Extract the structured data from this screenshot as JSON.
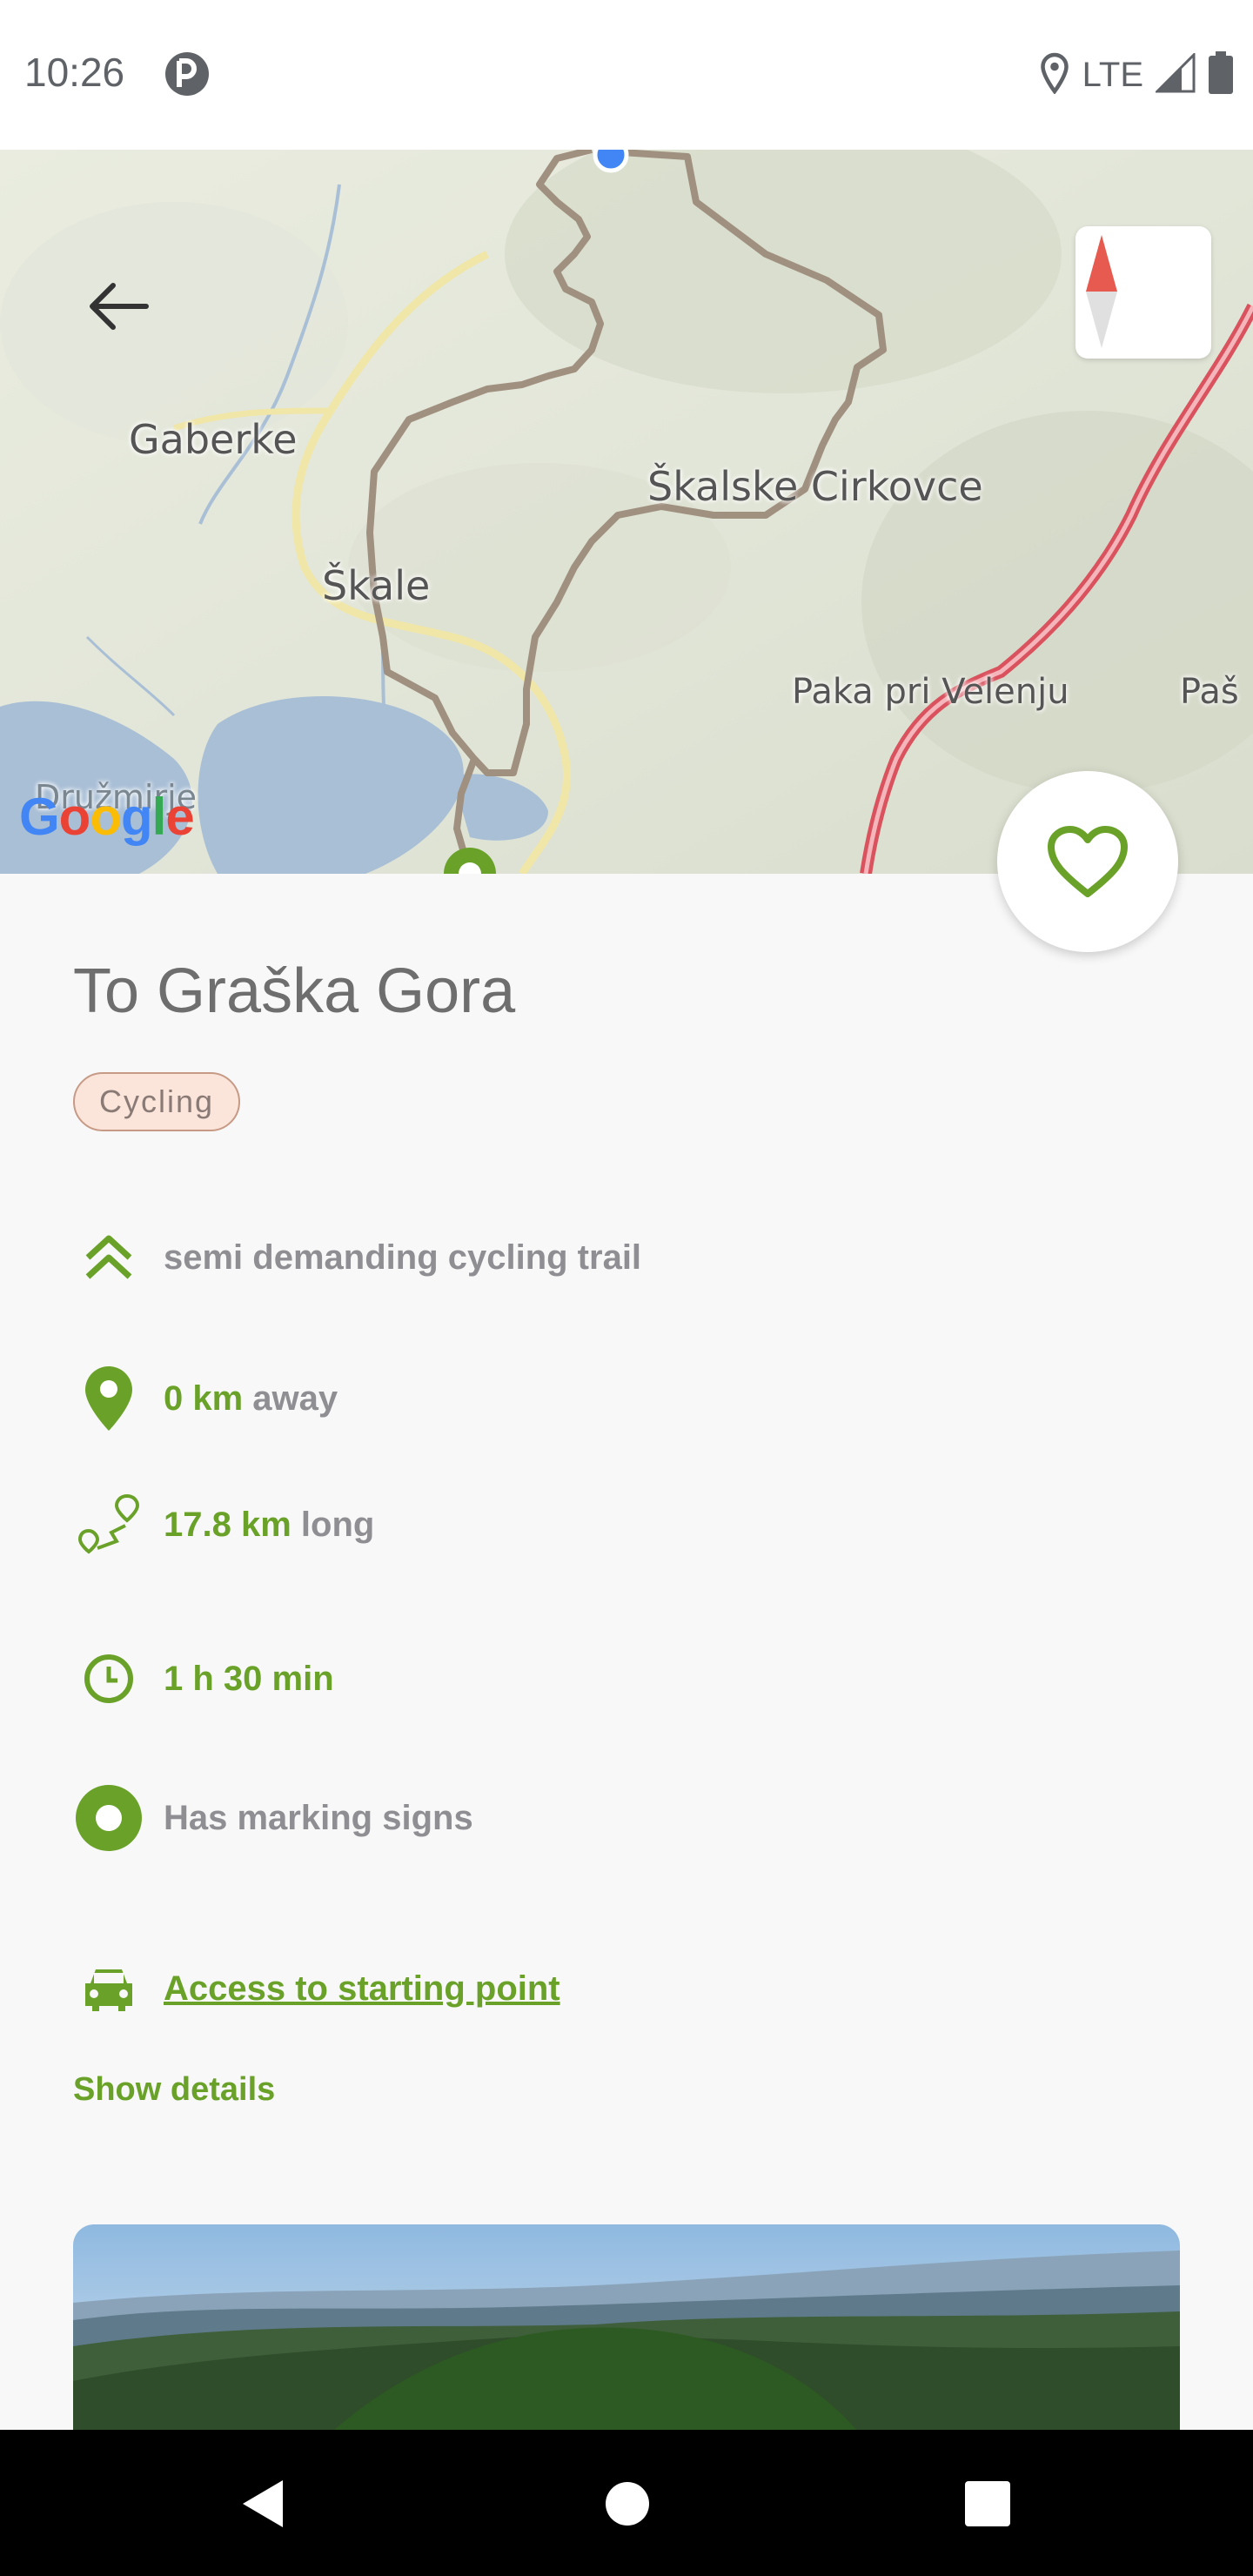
{
  "status_bar": {
    "time": "10:26",
    "network": "LTE",
    "icons": [
      "app-notification-icon",
      "location-icon",
      "signal-icon",
      "battery-icon"
    ]
  },
  "map": {
    "labels": {
      "gaberke": "Gaberke",
      "skale": "Škale",
      "skalske_cirkovce": "Škalske Cirkovce",
      "paka_pri_velenju": "Paka pri Velenju",
      "pas": "Paš",
      "druzmirje": "Družmirje"
    },
    "google_letters": [
      "G",
      "o",
      "o",
      "g",
      "l",
      "e"
    ],
    "google_colors": [
      "#4285F4",
      "#EA4335",
      "#FBBC05",
      "#4285F4",
      "#34A853",
      "#EA4335"
    ],
    "route_color": "#a09080"
  },
  "trail": {
    "title": "To Graška Gora",
    "tag": "Cycling",
    "difficulty": "semi demanding cycling trail",
    "distance_away_value": "0 km",
    "distance_away_suffix": "away",
    "length_value": "17.8 km",
    "length_suffix": "long",
    "duration": "1 h 30 min",
    "marking": "Has marking signs",
    "access_link": "Access to starting point",
    "show_details": "Show details"
  },
  "colors": {
    "accent_green": "#6aa229",
    "tag_bg": "#fbe4da",
    "tag_border": "#c79a86"
  }
}
